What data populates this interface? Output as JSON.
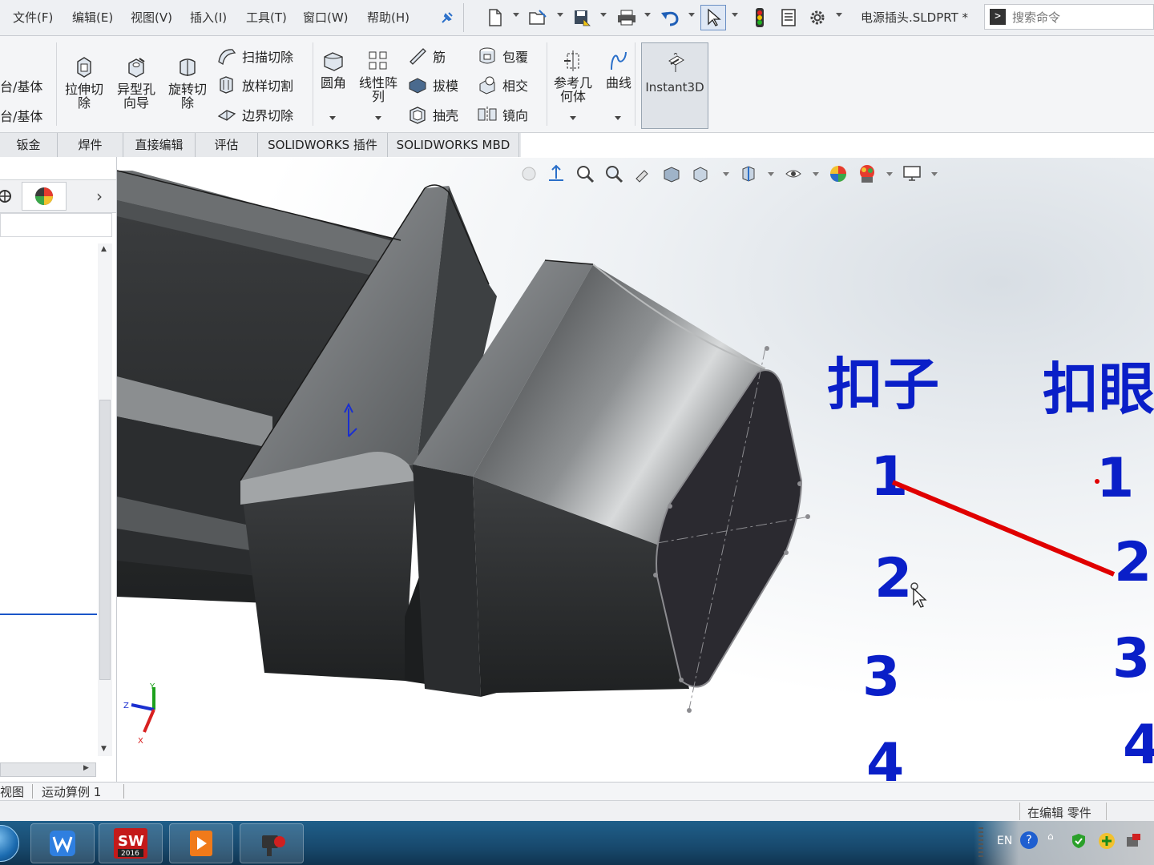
{
  "menubar": {
    "items": [
      "文件(F)",
      "编辑(E)",
      "视图(V)",
      "插入(I)",
      "工具(T)",
      "窗口(W)",
      "帮助(H)"
    ],
    "document_title": "电源插头.SLDPRT *",
    "search_placeholder": "搜索命令"
  },
  "ribbon": {
    "left_partial": [
      "台/基体",
      "台/基体"
    ],
    "extrude_cut": "拉伸切\n除",
    "hole_wizard": "异型孔\n向导",
    "revolve_cut": "旋转切\n除",
    "swept_cut": "扫描切除",
    "lofted_cut": "放样切割",
    "boundary_cut": "边界切除",
    "fillet": "圆角",
    "linear_pattern": "线性阵\n列",
    "rib": "筋",
    "draft": "拔模",
    "shell": "抽壳",
    "wrap": "包覆",
    "intersect": "相交",
    "mirror": "镜向",
    "reference_geometry": "参考几\n何体",
    "curves": "曲线",
    "instant3d": "Instant3D"
  },
  "tabs": [
    "钣金",
    "焊件",
    "直接编辑",
    "评估",
    "SOLIDWORKS 插件",
    "SOLIDWORKS MBD"
  ],
  "bottom_tabs": [
    "视图",
    "运动算例 1"
  ],
  "status": "在编辑 零件",
  "tray": {
    "lang": "EN"
  },
  "annotations": {
    "left_title": "扣子",
    "right_title": "扣眼",
    "left_numbers": [
      "1",
      "2",
      "3",
      "4"
    ],
    "right_numbers": [
      "1",
      "2",
      "3",
      "4"
    ],
    "connector_color": "#e00000",
    "text_color": "#0a1fc8"
  }
}
